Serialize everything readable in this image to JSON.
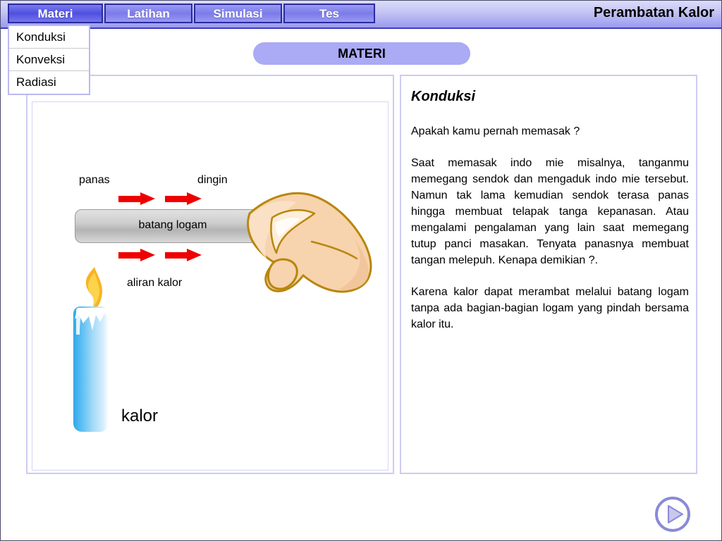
{
  "header": {
    "title": "Perambatan Kalor"
  },
  "tabs": [
    {
      "label": "Materi",
      "active": true
    },
    {
      "label": "Latihan",
      "active": false
    },
    {
      "label": "Simulasi",
      "active": false
    },
    {
      "label": "Tes",
      "active": false
    }
  ],
  "dropdown": {
    "items": [
      {
        "label": "Konduksi"
      },
      {
        "label": "Konveksi"
      },
      {
        "label": "Radiasi"
      }
    ]
  },
  "banner": {
    "label": "MATERI"
  },
  "illustration": {
    "label_hot": "panas",
    "label_cold": "dingin",
    "label_bar": "batang logam",
    "label_flow": "aliran kalor",
    "label_heat": "kalor"
  },
  "article": {
    "title": "Konduksi",
    "paragraphs": [
      "Apakah kamu pernah memasak ?",
      "Saat memasak indo mie misalnya, tanganmu memegang sendok dan mengaduk indo mie tersebut. Namun tak lama kemudian sendok terasa panas hingga membuat telapak tanga kepanasan. Atau mengalami pengalaman yang lain saat memegang tutup panci masakan. Tenyata panasnya membuat tangan melepuh. Kenapa demikian ?.",
      "Karena kalor dapat merambat melalui batang logam tanpa ada bagian-bagian logam yang pindah bersama kalor itu."
    ]
  },
  "footer": {
    "next_label": "next-button"
  },
  "colors": {
    "accent": "#4f4fe0",
    "header_gradient_top": "#dcdcf8",
    "header_gradient_bottom": "#9a9af0",
    "banner_fill": "#aaaaf5",
    "panel_border": "#ccccf2",
    "arrow_red": "#ee0000",
    "candle_blue": "#2fa8e8",
    "flame_orange": "#f5a623",
    "skin": "#f6cfa8",
    "skin_outline": "#b8860b"
  }
}
